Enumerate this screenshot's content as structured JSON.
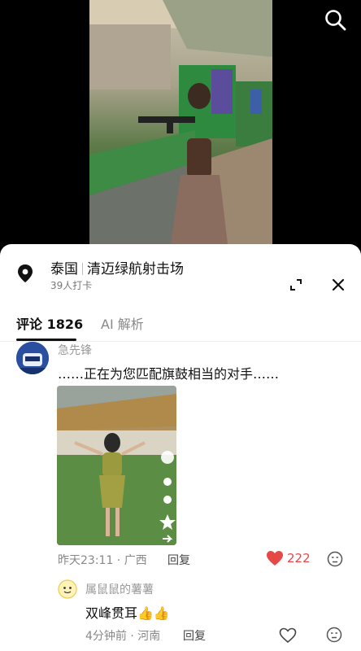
{
  "video": {
    "search_icon": "search-icon"
  },
  "location": {
    "country": "泰国",
    "place": "清迈绿航射击场",
    "checkins": "39人打卡",
    "pin_icon": "location-pin-icon",
    "expand_icon": "expand-icon",
    "close_icon": "close-icon"
  },
  "tabs": [
    {
      "label": "评论 1826",
      "active": true
    },
    {
      "label": "AI 解析",
      "active": false
    }
  ],
  "comment": {
    "user": "急先锋",
    "text": "……正在为您匹配旗鼓相当的对手……",
    "time": "昨天23:11 · 广西",
    "reply": "回复",
    "likes": "222",
    "liked": true
  },
  "reply": {
    "user": "属鼠鼠的薯薯",
    "text": "双峰贯耳👍👍",
    "time": "4分钟前 · 河南",
    "reply": "回复"
  },
  "colors": {
    "like": "#e64848",
    "text": "#111111",
    "muted": "#888888"
  }
}
